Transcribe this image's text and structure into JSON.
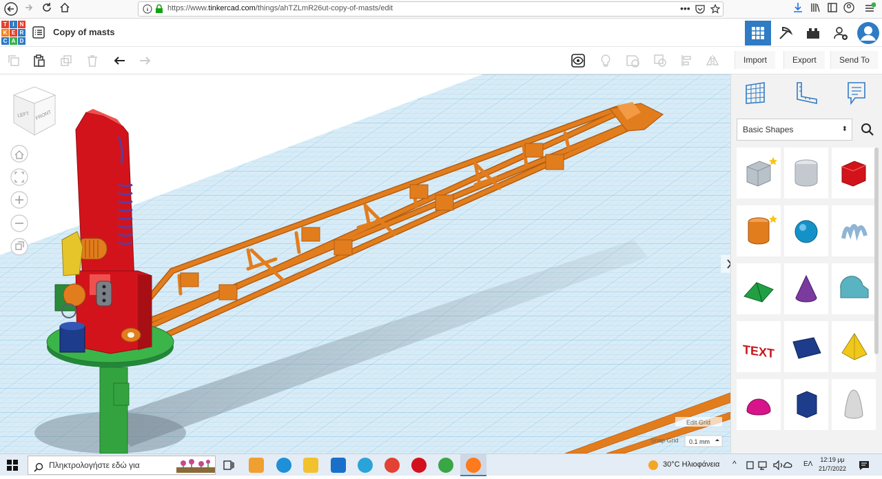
{
  "browser": {
    "url_prefix": "https://www.",
    "url_domain": "tinkercad.com",
    "url_path": "/things/ahTZLmR26ut-copy-of-masts/edit",
    "page_actions": "•••"
  },
  "app": {
    "logo_letters": [
      "T",
      "I",
      "N",
      "K",
      "E",
      "R",
      "C",
      "A",
      "D"
    ],
    "title": "Copy of masts"
  },
  "toolbar": {
    "import_label": "Import",
    "export_label": "Export",
    "send_to_label": "Send To"
  },
  "viewcube": {
    "left": "LEFT",
    "front": "FRONT"
  },
  "grid": {
    "edit_label": "Edit Grid",
    "snap_label": "Snap Grid",
    "snap_value": "0.1 mm"
  },
  "panel": {
    "category": "Basic Shapes",
    "shapes": [
      {
        "name": "box-hole",
        "color": "#b9c1c9",
        "starred": true
      },
      {
        "name": "cylinder-hole",
        "color": "#c4c9cf",
        "starred": false
      },
      {
        "name": "box",
        "color": "#d3131b",
        "starred": false
      },
      {
        "name": "cylinder",
        "color": "#e27d1d",
        "starred": true
      },
      {
        "name": "sphere",
        "color": "#1492c8",
        "starred": false
      },
      {
        "name": "scribble",
        "color": "#8fb4d4",
        "starred": false
      },
      {
        "name": "roof",
        "color": "#20a043",
        "starred": false
      },
      {
        "name": "cone",
        "color": "#7b3a9e",
        "starred": false
      },
      {
        "name": "round-roof",
        "color": "#5ab3c0",
        "starred": false
      },
      {
        "name": "text",
        "color": "#c8151e",
        "starred": false
      },
      {
        "name": "wedge",
        "color": "#1d3c8c",
        "starred": false
      },
      {
        "name": "pyramid",
        "color": "#f0c81a",
        "starred": false
      },
      {
        "name": "half-sphere",
        "color": "#d8148a",
        "starred": false
      },
      {
        "name": "polygon",
        "color": "#1d3c8c",
        "starred": false
      },
      {
        "name": "paraboloid",
        "color": "#d8d8d8",
        "starred": false
      }
    ]
  },
  "taskbar": {
    "search_placeholder": "Πληκτρολογήστε εδώ για",
    "weather": "30°C  Ηλιοφάνεια",
    "language": "ΕΛ",
    "time": "12:19 μμ",
    "date": "21/7/2022"
  },
  "colors": {
    "accent": "#2f7bc4",
    "boom": "#e27d1d",
    "tower": "#d3131b",
    "base": "#33a340",
    "grid_bg": "#d8ecf7",
    "grid_line": "#a9d3ea"
  }
}
